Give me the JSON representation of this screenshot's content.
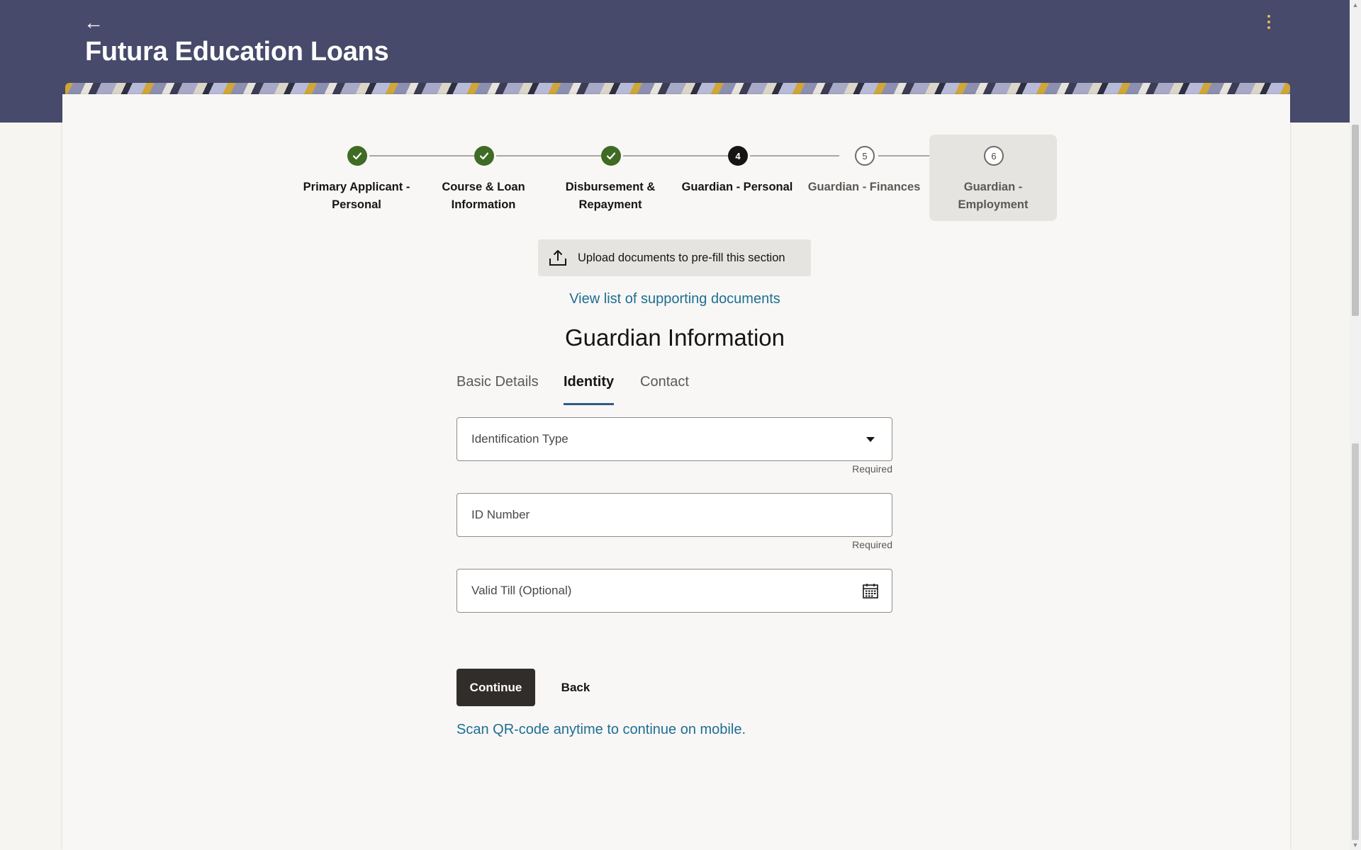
{
  "app": {
    "title": "Futura Education Loans"
  },
  "stepper": {
    "steps": [
      {
        "number": "1",
        "label": "Primary Applicant - Personal",
        "status": "complete"
      },
      {
        "number": "2",
        "label": "Course & Loan Information",
        "status": "complete"
      },
      {
        "number": "3",
        "label": "Disbursement & Repayment",
        "status": "complete"
      },
      {
        "number": "4",
        "label": "Guardian - Personal",
        "status": "current"
      },
      {
        "number": "5",
        "label": "Guardian - Finances",
        "status": "upcoming"
      },
      {
        "number": "6",
        "label": "Guardian - Employment",
        "status": "upcoming"
      }
    ]
  },
  "upload": {
    "label": "Upload documents to pre-fill this section"
  },
  "docs_link": "View list of supporting documents",
  "section_title": "Guardian Information",
  "tabs": [
    {
      "label": "Basic Details",
      "active": false
    },
    {
      "label": "Identity",
      "active": true
    },
    {
      "label": "Contact",
      "active": false
    }
  ],
  "form": {
    "identification_type": {
      "placeholder": "Identification Type",
      "hint": "Required"
    },
    "id_number": {
      "placeholder": "ID Number",
      "hint": "Required"
    },
    "valid_till": {
      "placeholder": "Valid Till (Optional)"
    }
  },
  "actions": {
    "continue_label": "Continue",
    "back_label": "Back"
  },
  "qr_link": "Scan QR-code anytime to continue on mobile.",
  "colors": {
    "header_bg": "#474a6a",
    "complete_step": "#3f6b24",
    "link": "#1e6e93",
    "primary_button": "#312d2a"
  }
}
